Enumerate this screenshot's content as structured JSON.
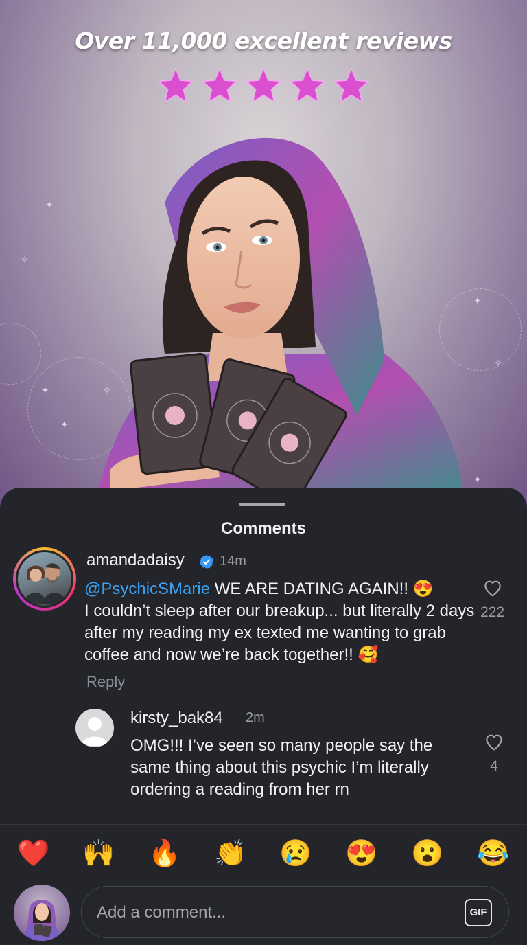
{
  "hero": {
    "headline": "Over 11,000 excellent reviews",
    "rating_stars": 5,
    "star_color": "#d94fcf"
  },
  "sheet": {
    "title": "Comments"
  },
  "comment": {
    "username": "amandadaisy",
    "verified": true,
    "time": "14m",
    "mention": "@PsychicSMarie",
    "text_line1": " WE ARE DATING AGAIN!! 😍",
    "text_rest": "I couldn’t sleep after our breakup... but literally 2 days after my reading my ex texted me wanting to grab coffee and now we’re back together!! 🥰",
    "likes": "222",
    "reply_label": "Reply"
  },
  "reply": {
    "username": "kirsty_bak84",
    "time": "2m",
    "text": "OMG!!! I’ve seen so many people say the same thing about this psychic I’m literally ordering a reading from her rn",
    "likes": "4"
  },
  "reactions": [
    "❤️",
    "🙌",
    "🔥",
    "👏",
    "😢",
    "😍",
    "😮",
    "😂"
  ],
  "composer": {
    "placeholder": "Add a comment...",
    "gif_label": "GIF"
  },
  "colors": {
    "sheet_bg": "#23252b",
    "mention": "#3aa0ef",
    "verified": "#3897f0"
  }
}
